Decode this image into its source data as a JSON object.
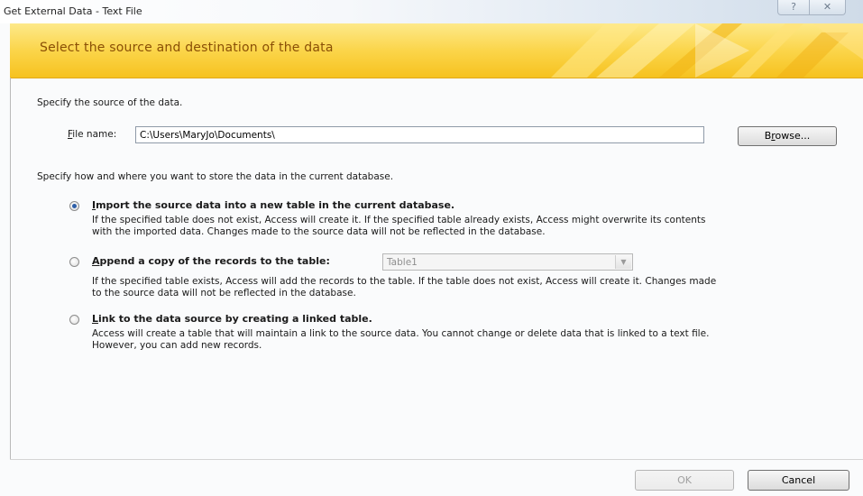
{
  "window": {
    "title": "Get External Data - Text File",
    "help_icon": "?",
    "close_icon": "✕"
  },
  "banner": {
    "heading": "Select the source and destination of the data"
  },
  "source": {
    "prompt": "Specify the source of the data.",
    "file_label_mnemonic": "F",
    "file_label_rest": "ile name:",
    "file_value": "C:\\Users\\MaryJo\\Documents\\",
    "browse_mnemonic_pre": "B",
    "browse_mnemonic": "r",
    "browse_rest": "owse..."
  },
  "store_prompt": "Specify how and where you want to store the data in the current database.",
  "options": [
    {
      "mnemonic": "I",
      "label_rest": "mport the source data into a new table in the current database.",
      "desc1": "If the specified table does not exist, Access will create it. If the specified table already exists, Access might overwrite its contents",
      "desc2": "with the imported data. Changes made to the source data will not be reflected in the database.",
      "selected": true
    },
    {
      "mnemonic": "A",
      "label_rest": "ppend a copy of the records to the table:",
      "table_value": "Table1",
      "desc1": "If the specified table exists, Access will add the records to the table. If the table does not exist, Access will create it. Changes made",
      "desc2": "to the source data will not be reflected in the database.",
      "selected": false
    },
    {
      "mnemonic": "L",
      "label_rest": "ink to the data source by creating a linked table.",
      "desc1": "Access will create a table that will maintain a link to the source data. You cannot change or delete data that is linked to a text file.",
      "desc2": "However, you can add new records.",
      "selected": false
    }
  ],
  "footer": {
    "ok_label": "OK",
    "cancel_label": "Cancel"
  },
  "colors": {
    "banner_gold": "#fbd54a",
    "banner_text": "#8a4f06",
    "radio_selected": "#2e5fa8"
  }
}
